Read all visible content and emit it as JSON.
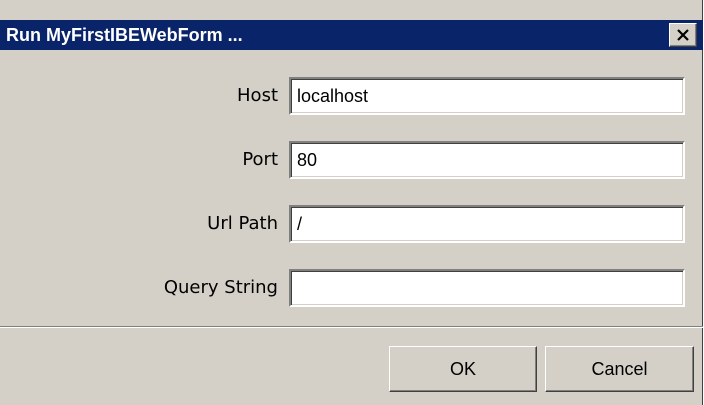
{
  "window": {
    "title": "Run MyFirstIBEWebForm ...",
    "close_icon": "close-icon"
  },
  "form": {
    "host": {
      "label": "Host",
      "value": "localhost"
    },
    "port": {
      "label": "Port",
      "value": "80"
    },
    "url_path": {
      "label": "Url Path",
      "value": "/"
    },
    "query_string": {
      "label": "Query String",
      "value": ""
    }
  },
  "buttons": {
    "ok_label": "OK",
    "cancel_label": "Cancel"
  },
  "colors": {
    "titlebar": "#0a246a",
    "dialog_face": "#d4d0c8",
    "field_background": "#ffffff"
  }
}
